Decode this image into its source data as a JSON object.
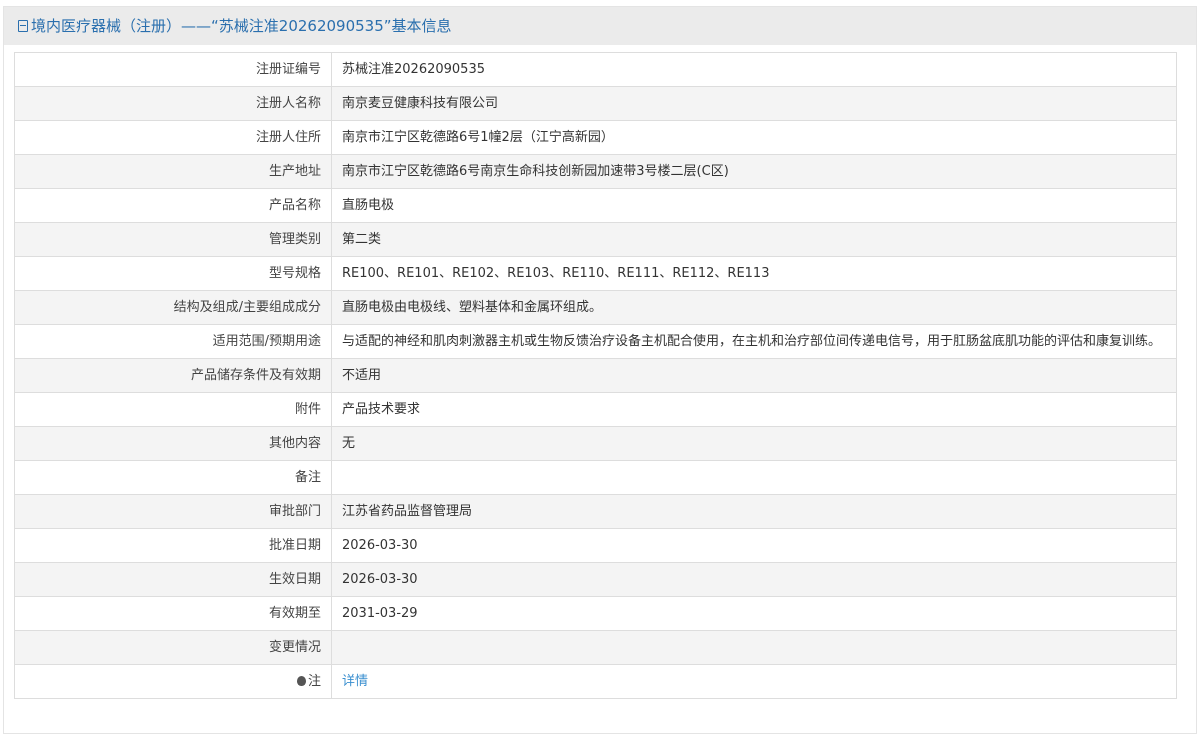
{
  "header": {
    "title": "境内医疗器械（注册）——“苏械注准20262090535”基本信息"
  },
  "rows": [
    {
      "label": "注册证编号",
      "value": "苏械注准20262090535"
    },
    {
      "label": "注册人名称",
      "value": "南京麦豆健康科技有限公司"
    },
    {
      "label": "注册人住所",
      "value": "南京市江宁区乾德路6号1幢2层（江宁高新园）"
    },
    {
      "label": "生产地址",
      "value": "南京市江宁区乾德路6号南京生命科技创新园加速带3号楼二层(C区)"
    },
    {
      "label": "产品名称",
      "value": "直肠电极"
    },
    {
      "label": "管理类别",
      "value": "第二类"
    },
    {
      "label": "型号规格",
      "value": "RE100、RE101、RE102、RE103、RE110、RE111、RE112、RE113"
    },
    {
      "label": "结构及组成/主要组成成分",
      "value": "直肠电极由电极线、塑料基体和金属环组成。"
    },
    {
      "label": "适用范围/预期用途",
      "value": "与适配的神经和肌肉刺激器主机或生物反馈治疗设备主机配合使用，在主机和治疗部位间传递电信号，用于肛肠盆底肌功能的评估和康复训练。"
    },
    {
      "label": "产品储存条件及有效期",
      "value": "不适用"
    },
    {
      "label": "附件",
      "value": "产品技术要求"
    },
    {
      "label": "其他内容",
      "value": "无"
    },
    {
      "label": "备注",
      "value": ""
    },
    {
      "label": "审批部门",
      "value": "江苏省药品监督管理局"
    },
    {
      "label": "批准日期",
      "value": "2026-03-30"
    },
    {
      "label": "生效日期",
      "value": "2026-03-30"
    },
    {
      "label": "有效期至",
      "value": "2031-03-29"
    },
    {
      "label": "变更情况",
      "value": ""
    }
  ],
  "note": {
    "label": "注",
    "link": "详情"
  }
}
